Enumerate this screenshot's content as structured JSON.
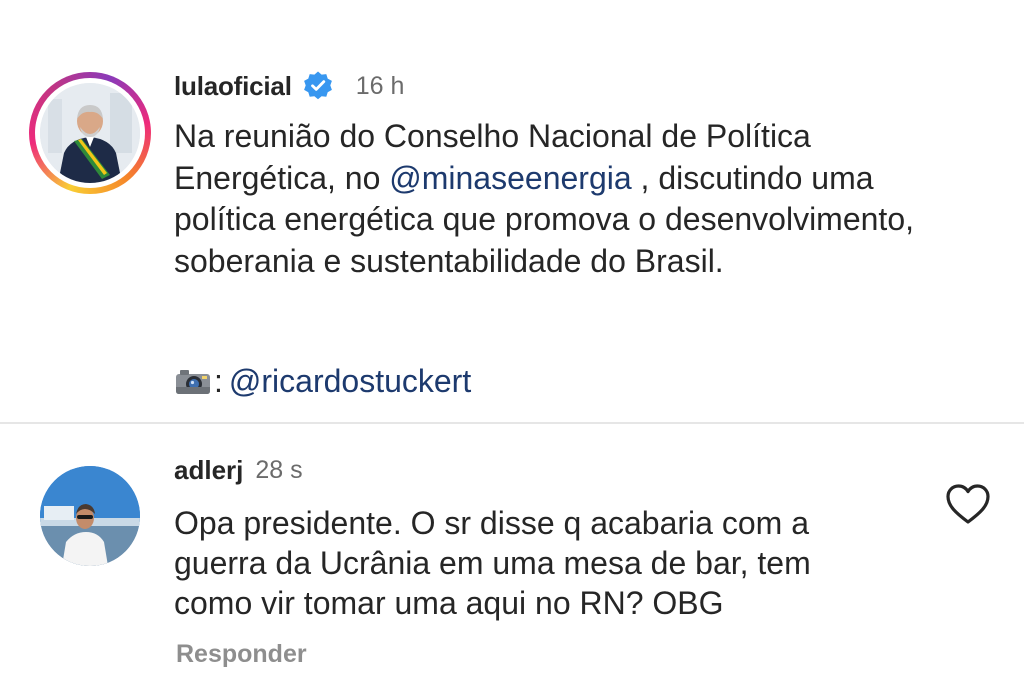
{
  "post": {
    "username": "lulaoficial",
    "time": "16 h",
    "text_part1": "Na reunião do Conselho Nacional de Política Energética, no ",
    "mention_1": "@minaseenergia",
    "text_part2": " , discutindo uma política energética que promova o desenvolvimento, soberania e sustentabilidade do Brasil.",
    "credit_suffix": ":",
    "credit_mention": "@ricardostuckert",
    "icons": {
      "verified": "verified-badge-icon",
      "camera": "camera-icon"
    }
  },
  "comment": {
    "username": "adlerj",
    "time": "28 s",
    "text": "Opa presidente. O sr disse q acabaria com a guerra da Ucrânia em uma mesa de bar, tem como vir tomar uma aqui no RN? OBG",
    "reply_label": "Responder",
    "icons": {
      "like": "heart-icon"
    }
  },
  "colors": {
    "verified_blue": "#3897f0",
    "mention_blue": "#1d3a6e",
    "muted_gray": "#8e8e8e"
  }
}
